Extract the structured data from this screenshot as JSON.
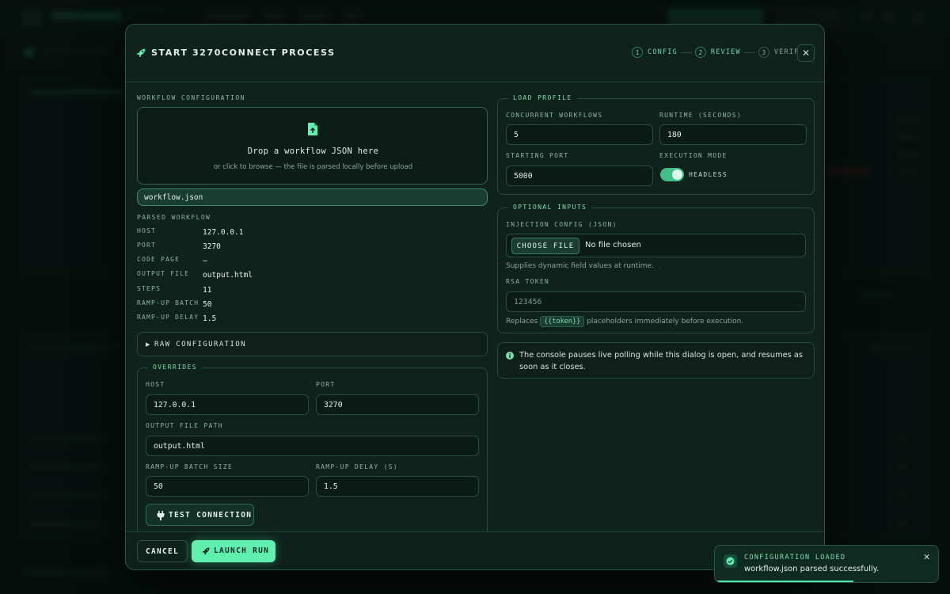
{
  "dialog": {
    "title": "START 3270CONNECT PROCESS",
    "steps": [
      {
        "num": "1",
        "label": "CONFIG"
      },
      {
        "num": "2",
        "label": "REVIEW"
      },
      {
        "num": "3",
        "label": "VERIFY"
      }
    ],
    "close": "✕"
  },
  "workflow": {
    "section_label": "WORKFLOW CONFIGURATION",
    "drop_title": "Drop a workflow JSON here",
    "drop_sub": "or click to browse — the file is parsed locally before upload",
    "file_name": "workflow.json",
    "parsed_label": "PARSED WORKFLOW",
    "parsed": [
      {
        "key": "HOST",
        "value": "127.0.0.1"
      },
      {
        "key": "PORT",
        "value": "3270"
      },
      {
        "key": "CODE PAGE",
        "value": "—"
      },
      {
        "key": "OUTPUT FILE",
        "value": "output.html"
      },
      {
        "key": "STEPS",
        "value": "11"
      },
      {
        "key": "RAMP-UP BATCH",
        "value": "50"
      },
      {
        "key": "RAMP-UP DELAY",
        "value": "1.5"
      }
    ],
    "raw_config_label": "RAW CONFIGURATION"
  },
  "overrides": {
    "legend": "OVERRIDES",
    "host_label": "HOST",
    "host": "127.0.0.1",
    "port_label": "PORT",
    "port": "3270",
    "output_label": "OUTPUT FILE PATH",
    "output": "output.html",
    "batch_label": "RAMP-UP BATCH SIZE",
    "batch": "50",
    "delay_label": "RAMP-UP DELAY (S)",
    "delay": "1.5",
    "test_label": "TEST CONNECTION"
  },
  "load_profile": {
    "legend": "LOAD PROFILE",
    "concurrent_label": "CONCURRENT WORKFLOWS",
    "concurrent": "5",
    "runtime_label": "RUNTIME (SECONDS)",
    "runtime": "180",
    "port_label": "STARTING PORT",
    "port": "5000",
    "mode_label": "EXECUTION MODE",
    "mode": "HEADLESS",
    "mode_on": true
  },
  "optional": {
    "legend": "OPTIONAL INPUTS",
    "injection_label": "INJECTION CONFIG (JSON)",
    "choose_label": "CHOOSE FILE",
    "no_file": "No file chosen",
    "injection_help": "Supplies dynamic field values at runtime.",
    "rsa_label": "RSA TOKEN",
    "rsa_placeholder": "123456",
    "rsa_help_pre": "Replaces",
    "rsa_help_token": "{{token}}",
    "rsa_help_post": "placeholders immediately before execution."
  },
  "note": "The console pauses live polling while this dialog is open, and resumes as soon as it closes.",
  "footer": {
    "cancel": "CANCEL",
    "launch": "LAUNCH RUN"
  },
  "toast": {
    "title": "CONFIGURATION LOADED",
    "message": "workflow.json parsed successfully.",
    "close": "✕",
    "progress": 0.62
  },
  "colors": {
    "accent": "#5ff0b0",
    "dialog_bg": "#0f231c",
    "border": "#2a5446"
  }
}
